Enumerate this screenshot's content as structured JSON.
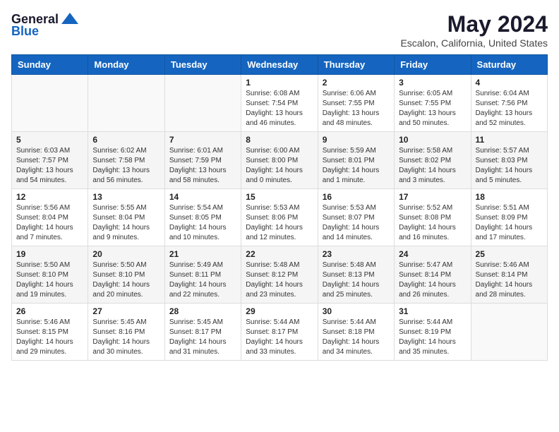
{
  "app": {
    "logo_general": "General",
    "logo_blue": "Blue",
    "month_title": "May 2024",
    "location": "Escalon, California, United States"
  },
  "calendar": {
    "headers": [
      "Sunday",
      "Monday",
      "Tuesday",
      "Wednesday",
      "Thursday",
      "Friday",
      "Saturday"
    ],
    "rows": [
      [
        {
          "day": "",
          "info": ""
        },
        {
          "day": "",
          "info": ""
        },
        {
          "day": "",
          "info": ""
        },
        {
          "day": "1",
          "info": "Sunrise: 6:08 AM\nSunset: 7:54 PM\nDaylight: 13 hours\nand 46 minutes."
        },
        {
          "day": "2",
          "info": "Sunrise: 6:06 AM\nSunset: 7:55 PM\nDaylight: 13 hours\nand 48 minutes."
        },
        {
          "day": "3",
          "info": "Sunrise: 6:05 AM\nSunset: 7:55 PM\nDaylight: 13 hours\nand 50 minutes."
        },
        {
          "day": "4",
          "info": "Sunrise: 6:04 AM\nSunset: 7:56 PM\nDaylight: 13 hours\nand 52 minutes."
        }
      ],
      [
        {
          "day": "5",
          "info": "Sunrise: 6:03 AM\nSunset: 7:57 PM\nDaylight: 13 hours\nand 54 minutes."
        },
        {
          "day": "6",
          "info": "Sunrise: 6:02 AM\nSunset: 7:58 PM\nDaylight: 13 hours\nand 56 minutes."
        },
        {
          "day": "7",
          "info": "Sunrise: 6:01 AM\nSunset: 7:59 PM\nDaylight: 13 hours\nand 58 minutes."
        },
        {
          "day": "8",
          "info": "Sunrise: 6:00 AM\nSunset: 8:00 PM\nDaylight: 14 hours\nand 0 minutes."
        },
        {
          "day": "9",
          "info": "Sunrise: 5:59 AM\nSunset: 8:01 PM\nDaylight: 14 hours\nand 1 minute."
        },
        {
          "day": "10",
          "info": "Sunrise: 5:58 AM\nSunset: 8:02 PM\nDaylight: 14 hours\nand 3 minutes."
        },
        {
          "day": "11",
          "info": "Sunrise: 5:57 AM\nSunset: 8:03 PM\nDaylight: 14 hours\nand 5 minutes."
        }
      ],
      [
        {
          "day": "12",
          "info": "Sunrise: 5:56 AM\nSunset: 8:04 PM\nDaylight: 14 hours\nand 7 minutes."
        },
        {
          "day": "13",
          "info": "Sunrise: 5:55 AM\nSunset: 8:04 PM\nDaylight: 14 hours\nand 9 minutes."
        },
        {
          "day": "14",
          "info": "Sunrise: 5:54 AM\nSunset: 8:05 PM\nDaylight: 14 hours\nand 10 minutes."
        },
        {
          "day": "15",
          "info": "Sunrise: 5:53 AM\nSunset: 8:06 PM\nDaylight: 14 hours\nand 12 minutes."
        },
        {
          "day": "16",
          "info": "Sunrise: 5:53 AM\nSunset: 8:07 PM\nDaylight: 14 hours\nand 14 minutes."
        },
        {
          "day": "17",
          "info": "Sunrise: 5:52 AM\nSunset: 8:08 PM\nDaylight: 14 hours\nand 16 minutes."
        },
        {
          "day": "18",
          "info": "Sunrise: 5:51 AM\nSunset: 8:09 PM\nDaylight: 14 hours\nand 17 minutes."
        }
      ],
      [
        {
          "day": "19",
          "info": "Sunrise: 5:50 AM\nSunset: 8:10 PM\nDaylight: 14 hours\nand 19 minutes."
        },
        {
          "day": "20",
          "info": "Sunrise: 5:50 AM\nSunset: 8:10 PM\nDaylight: 14 hours\nand 20 minutes."
        },
        {
          "day": "21",
          "info": "Sunrise: 5:49 AM\nSunset: 8:11 PM\nDaylight: 14 hours\nand 22 minutes."
        },
        {
          "day": "22",
          "info": "Sunrise: 5:48 AM\nSunset: 8:12 PM\nDaylight: 14 hours\nand 23 minutes."
        },
        {
          "day": "23",
          "info": "Sunrise: 5:48 AM\nSunset: 8:13 PM\nDaylight: 14 hours\nand 25 minutes."
        },
        {
          "day": "24",
          "info": "Sunrise: 5:47 AM\nSunset: 8:14 PM\nDaylight: 14 hours\nand 26 minutes."
        },
        {
          "day": "25",
          "info": "Sunrise: 5:46 AM\nSunset: 8:14 PM\nDaylight: 14 hours\nand 28 minutes."
        }
      ],
      [
        {
          "day": "26",
          "info": "Sunrise: 5:46 AM\nSunset: 8:15 PM\nDaylight: 14 hours\nand 29 minutes."
        },
        {
          "day": "27",
          "info": "Sunrise: 5:45 AM\nSunset: 8:16 PM\nDaylight: 14 hours\nand 30 minutes."
        },
        {
          "day": "28",
          "info": "Sunrise: 5:45 AM\nSunset: 8:17 PM\nDaylight: 14 hours\nand 31 minutes."
        },
        {
          "day": "29",
          "info": "Sunrise: 5:44 AM\nSunset: 8:17 PM\nDaylight: 14 hours\nand 33 minutes."
        },
        {
          "day": "30",
          "info": "Sunrise: 5:44 AM\nSunset: 8:18 PM\nDaylight: 14 hours\nand 34 minutes."
        },
        {
          "day": "31",
          "info": "Sunrise: 5:44 AM\nSunset: 8:19 PM\nDaylight: 14 hours\nand 35 minutes."
        },
        {
          "day": "",
          "info": ""
        }
      ]
    ]
  }
}
